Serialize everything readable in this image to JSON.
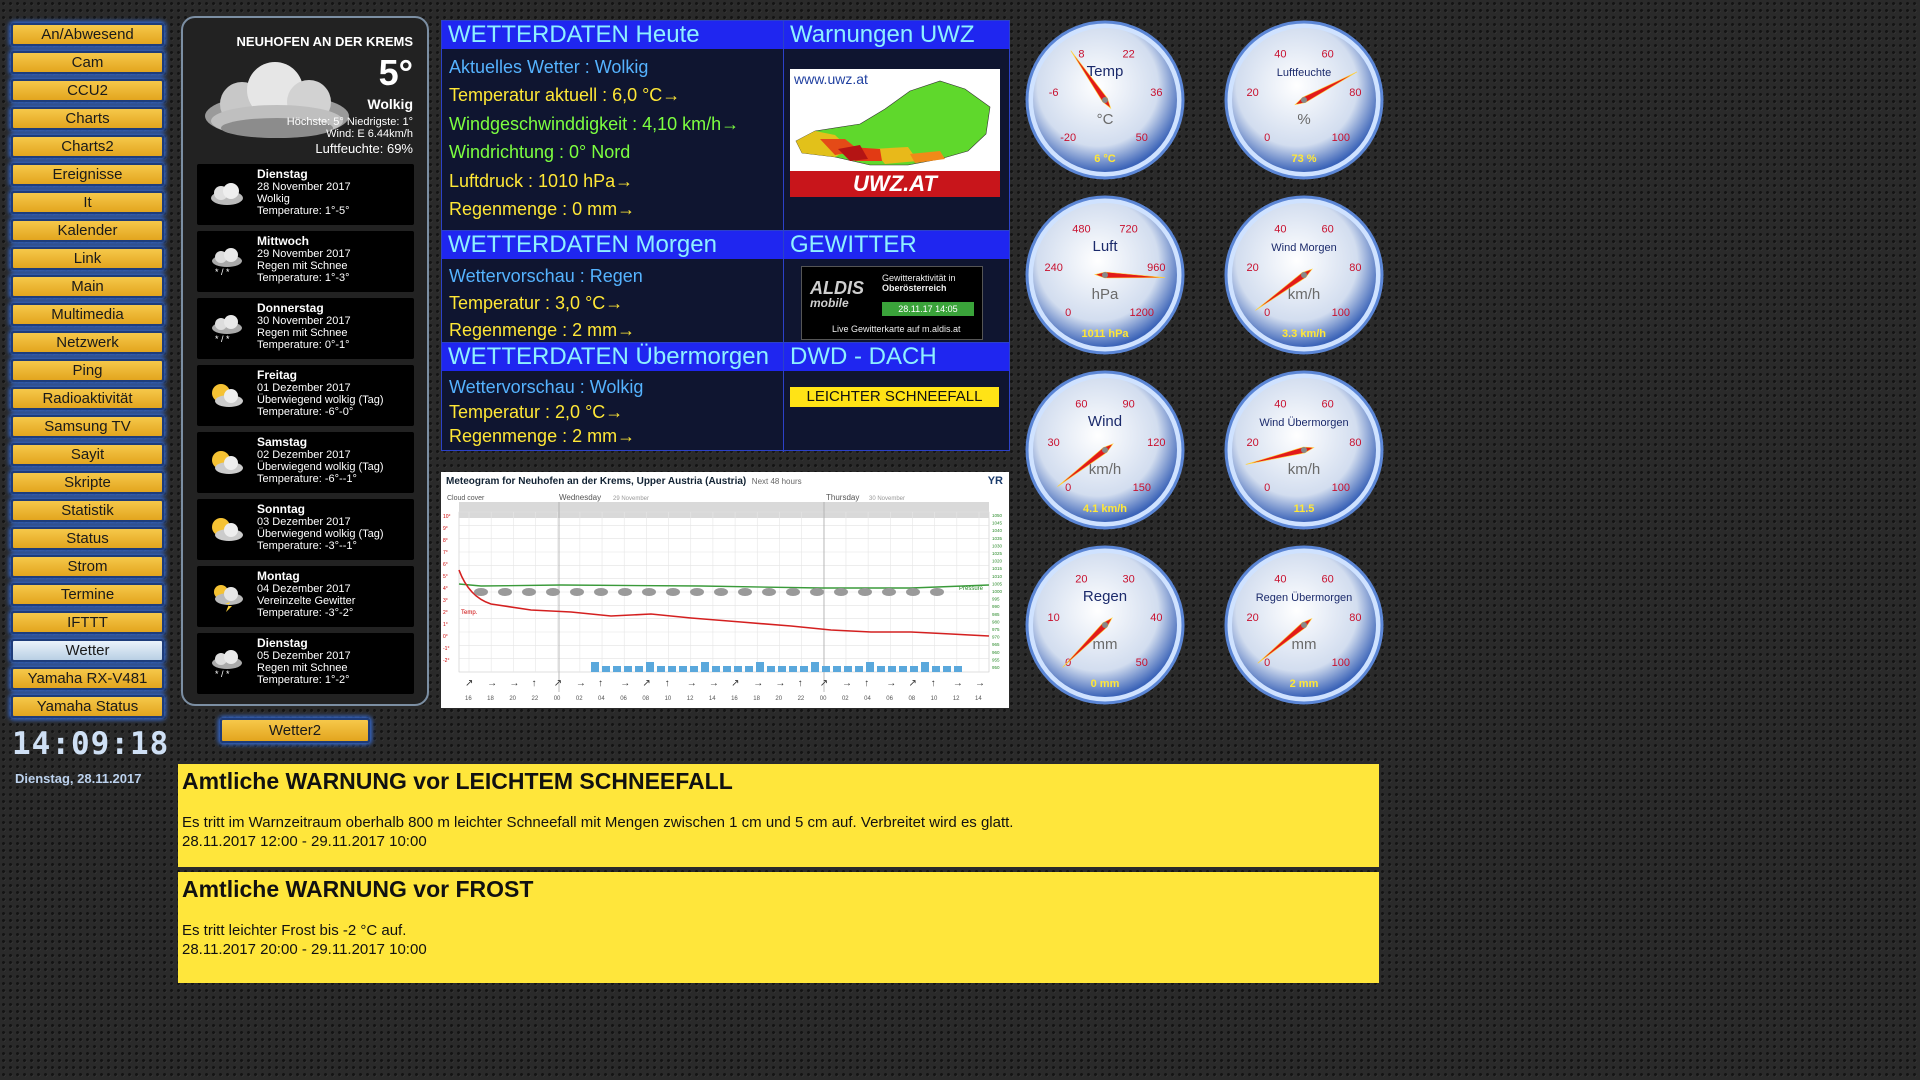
{
  "nav": {
    "items": [
      "An/Abwesend",
      "Cam",
      "CCU2",
      "Charts",
      "Charts2",
      "Ereignisse",
      "It",
      "Kalender",
      "Link",
      "Main",
      "Multimedia",
      "Netzwerk",
      "Ping",
      "Radioaktivität",
      "Samsung TV",
      "Sayit",
      "Skripte",
      "Statistik",
      "Status",
      "Strom",
      "Termine",
      "IFTTT",
      "Wetter",
      "Yamaha RX-V481",
      "Yamaha Status"
    ],
    "active": "Wetter"
  },
  "clock": {
    "time": "14:09:18",
    "date": "Dienstag, 28.11.2017"
  },
  "forecast": {
    "town": "NEUHOFEN AN DER KREMS",
    "temp": "5°",
    "condition": "Wolkig",
    "highlow": "Höchste: 5° Niedrigste: 1°",
    "wind": "Wind: E 6.44km/h",
    "humidity": "Luftfeuchte: 69%",
    "days": [
      {
        "name": "Dienstag",
        "date": "28 November 2017",
        "text": "Wolkig",
        "temp": "Temperature: 1°-5°",
        "icon": "cloud-icon"
      },
      {
        "name": "Mittwoch",
        "date": "29 November 2017",
        "text": "Regen mit Schnee",
        "temp": "Temperature: 1°-3°",
        "icon": "snow-rain-icon"
      },
      {
        "name": "Donnerstag",
        "date": "30 November 2017",
        "text": "Regen mit Schnee",
        "temp": "Temperature: 0°-1°",
        "icon": "snow-rain-icon"
      },
      {
        "name": "Freitag",
        "date": "01 Dezember 2017",
        "text": "Überwiegend wolkig (Tag)",
        "temp": "Temperature: -6°-0°",
        "icon": "sun-cloud-icon"
      },
      {
        "name": "Samstag",
        "date": "02 Dezember 2017",
        "text": "Überwiegend wolkig (Tag)",
        "temp": "Temperature: -6°--1°",
        "icon": "sun-cloud-icon"
      },
      {
        "name": "Sonntag",
        "date": "03 Dezember 2017",
        "text": "Überwiegend wolkig (Tag)",
        "temp": "Temperature: -3°--1°",
        "icon": "sun-cloud-icon"
      },
      {
        "name": "Montag",
        "date": "04 Dezember 2017",
        "text": "Vereinzelte Gewitter",
        "temp": "Temperature: -3°-2°",
        "icon": "thunder-icon"
      },
      {
        "name": "Dienstag",
        "date": "05 Dezember 2017",
        "text": "Regen mit Schnee",
        "temp": "Temperature: 1°-2°",
        "icon": "snow-rain-icon"
      }
    ],
    "button": "Wetter2"
  },
  "table": {
    "today": {
      "header": "WETTERDATEN Heute",
      "lines": [
        "Aktuelles Wetter : Wolkig",
        "Temperatur aktuell : 6,0 °C→",
        "Windgeschwinddigkeit : 4,10 km/h→",
        "Windrichtung : 0° Nord",
        "Luftdruck : 1010 hPa→",
        "Regenmenge : 0 mm→"
      ]
    },
    "uwz": {
      "header": "Warnungen UWZ",
      "url": "www.uwz.at",
      "logo": "UWZ.AT"
    },
    "tomorrow": {
      "header": "WETTERDATEN Morgen",
      "lines": [
        "Wettervorschau : Regen",
        "Temperatur : 3,0 °C→",
        "Regenmenge : 2 mm→"
      ]
    },
    "storm": {
      "header": "GEWITTER",
      "logo": "ALDIS",
      "logo_sub": "mobile",
      "line1": "Gewitteraktivität in",
      "line2": "Oberösterreich",
      "time": "28.11.17 14:05",
      "footer": "Live Gewitterkarte auf m.aldis.at"
    },
    "after": {
      "header": "WETTERDATEN Übermorgen",
      "lines": [
        "Wettervorschau : Wolkig",
        "Temperatur : 2,0 °C→",
        "Regenmenge : 2 mm→"
      ]
    },
    "dwd": {
      "header": "DWD - DACH",
      "badge": "LEICHTER SCHNEEFALL"
    }
  },
  "meteogram": {
    "title": "Meteogram for Neuhofen an der Krems, Upper Austria (Austria)",
    "subtitle": "Next 48 hours",
    "logo": "YR",
    "cloud_label": "Cloud cover",
    "day1": "Wednesday",
    "day1_date": "29 November",
    "day2": "Thursday",
    "day2_date": "30 November",
    "pressure_label": "Pressure",
    "temp_label": "Temp.",
    "hours": [
      "16",
      "18",
      "20",
      "22",
      "00",
      "02",
      "04",
      "06",
      "08",
      "10",
      "12",
      "14",
      "16",
      "18",
      "20",
      "22",
      "00",
      "02",
      "04",
      "06",
      "08",
      "10",
      "12",
      "14"
    ],
    "pressure_ticks": [
      "1050",
      "1045",
      "1040",
      "1035",
      "1030",
      "1025",
      "1020",
      "1015",
      "1010",
      "1005",
      "1000",
      "995",
      "990",
      "985",
      "980",
      "975",
      "970",
      "965",
      "960",
      "955",
      "950"
    ],
    "temp_ticks": [
      "10°",
      "9°",
      "8°",
      "7°",
      "6°",
      "5°",
      "4°",
      "3°",
      "2°",
      "1°",
      "0°",
      "-1°",
      "-2°"
    ]
  },
  "gauges": [
    {
      "title": "Temp",
      "unit": "°C",
      "value_label": "6 °C",
      "ticks": [
        "-20",
        "-6",
        "8",
        "22",
        "36",
        "50"
      ],
      "min": -20,
      "max": 50,
      "value": 6
    },
    {
      "title": "Luftfeuchte",
      "unit": "%",
      "value_label": "73 %",
      "ticks": [
        "0",
        "20",
        "40",
        "60",
        "80",
        "100"
      ],
      "min": 0,
      "max": 100,
      "value": 73
    },
    {
      "title": "Luft",
      "unit": "hPa",
      "value_label": "1011 hPa",
      "ticks": [
        "0",
        "240",
        "480",
        "720",
        "960",
        "1200"
      ],
      "min": 0,
      "max": 1200,
      "value": 1011
    },
    {
      "title": "Wind Morgen",
      "unit": "km/h",
      "value_label": "3.3 km/h",
      "ticks": [
        "0",
        "20",
        "40",
        "60",
        "80",
        "100"
      ],
      "min": 0,
      "max": 100,
      "value": 3.3
    },
    {
      "title": "Wind",
      "unit": "km/h",
      "value_label": "4.1 km/h",
      "ticks": [
        "0",
        "30",
        "60",
        "90",
        "120",
        "150"
      ],
      "min": 0,
      "max": 150,
      "value": 4.1
    },
    {
      "title": "Wind Übermorgen",
      "unit": "km/h",
      "value_label": "11.5",
      "ticks": [
        "0",
        "20",
        "40",
        "60",
        "80",
        "100"
      ],
      "min": 0,
      "max": 100,
      "value": 11.5
    },
    {
      "title": "Regen",
      "unit": "mm",
      "value_label": "0 mm",
      "ticks": [
        "0",
        "10",
        "20",
        "30",
        "40",
        "50"
      ],
      "min": 0,
      "max": 50,
      "value": 0
    },
    {
      "title": "Regen Übermorgen",
      "unit": "mm",
      "value_label": "2 mm",
      "ticks": [
        "0",
        "20",
        "40",
        "60",
        "80",
        "100"
      ],
      "min": 0,
      "max": 100,
      "value": 2
    }
  ],
  "warnings": [
    {
      "title": "Amtliche WARNUNG vor LEICHTEM SCHNEEFALL",
      "text": "Es tritt im Warnzeitraum oberhalb 800 m leichter Schneefall mit Mengen zwischen 1 cm und 5 cm auf. Verbreitet wird es glatt.",
      "period": "28.11.2017 12:00 - 29.11.2017 10:00"
    },
    {
      "title": "Amtliche WARNUNG vor FROST",
      "text": "Es tritt leichter Frost bis -2 °C auf.",
      "period": "28.11.2017 20:00 - 29.11.2017 10:00"
    }
  ],
  "colors": {
    "accent": "#1f26f0",
    "header_text": "#8ef0ff",
    "warning_bg": "#ffe63b",
    "nav_button": "#f0b933",
    "needle": "#e21a1a"
  }
}
